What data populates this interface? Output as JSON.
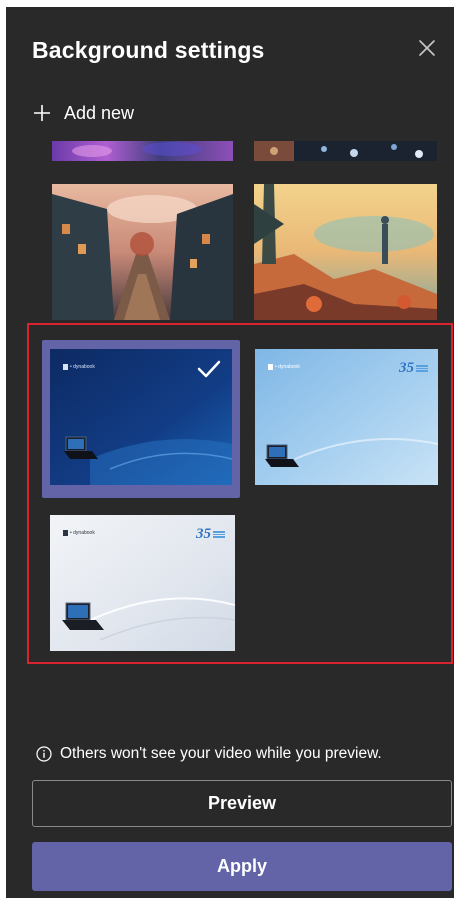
{
  "panel": {
    "title": "Background settings",
    "add_new_label": "Add new",
    "info_text": "Others won't see your video while you preview.",
    "preview_label": "Preview",
    "apply_label": "Apply"
  },
  "backgrounds": [
    {
      "name": "purple-abstract",
      "selected": false
    },
    {
      "name": "dark-sparkle",
      "selected": false
    },
    {
      "name": "fantasy-village-street",
      "selected": false
    },
    {
      "name": "autumn-landscape-figure",
      "selected": false
    },
    {
      "name": "dynabook-dark-blue",
      "selected": true
    },
    {
      "name": "dynabook-light-blue",
      "selected": false
    },
    {
      "name": "dynabook-white",
      "selected": false
    }
  ],
  "icons": {
    "close": "close-icon",
    "add": "plus-icon",
    "selected": "checkmark-icon",
    "info": "info-icon"
  },
  "colors": {
    "panel_bg": "#292929",
    "accent": "#6264a7",
    "highlight": "#d9232f"
  }
}
